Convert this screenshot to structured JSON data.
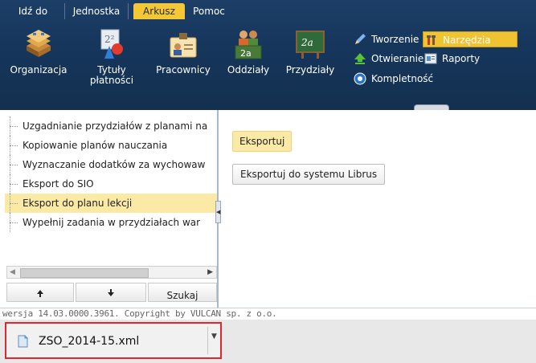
{
  "menu_tabs": [
    "Idź do",
    "Jednostka",
    "Arkusz",
    "Pomoc"
  ],
  "active_menu_tab": "Arkusz",
  "ribbon": {
    "large_buttons": [
      {
        "label": "Organizacja",
        "icon": "building-stack-icon"
      },
      {
        "label": "Tytuły płatności",
        "icon": "power-formula-icon"
      },
      {
        "label": "Pracownicy",
        "icon": "employee-card-icon"
      },
      {
        "label": "Oddziały",
        "icon": "class-group-icon"
      },
      {
        "label": "Przydziały",
        "icon": "chalkboard-icon"
      }
    ],
    "small_buttons": [
      {
        "label": "Tworzenie",
        "icon": "pencil-icon"
      },
      {
        "label": "Otwieranie",
        "icon": "upload-arrow-icon"
      },
      {
        "label": "Kompletność",
        "icon": "check-circle-icon"
      },
      {
        "label": "Narzędzia",
        "icon": "tools-icon",
        "active": true
      },
      {
        "label": "Raporty",
        "icon": "report-icon"
      }
    ]
  },
  "tree": {
    "items": [
      "Uzgadnianie przydziałów z planami na",
      "Kopiowanie planów nauczania",
      "Wyznaczanie dodatków za wychowaw",
      "Eksport do SIO",
      "Eksport do planu lekcji",
      "Wypełnij zadania w przydziałach war"
    ],
    "selected": "Eksport do planu lekcji"
  },
  "nav": {
    "up_icon": "arrow-up-icon",
    "down_icon": "arrow-down-icon",
    "search_label": "Szukaj"
  },
  "content": {
    "export_label": "Eksportuj",
    "librus_label": "Eksportuj do systemu Librus"
  },
  "footer": {
    "version": "wersja 14.03.0000.3961. Copyright by VULCAN sp. z o.o."
  },
  "download": {
    "filename": "ZSO_2014-15.xml"
  },
  "colors": {
    "ribbon_bg": "#16365c",
    "accent": "#f3c736",
    "selection": "#fbe9a6",
    "highlight_border": "#e2262b"
  }
}
